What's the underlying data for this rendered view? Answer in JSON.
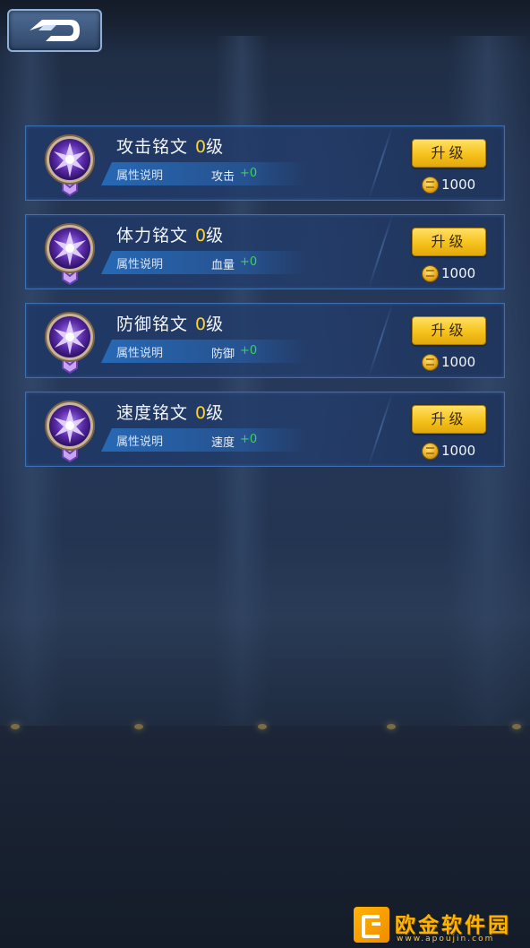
{
  "header": {
    "back_icon": "back-arrow-icon"
  },
  "runes": [
    {
      "name": "攻击铭文",
      "level": "0",
      "level_unit": "级",
      "attr_label": "属性说明",
      "attr_name": "攻击",
      "attr_value": "+0",
      "upgrade_label": "升级",
      "cost": "1000"
    },
    {
      "name": "体力铭文",
      "level": "0",
      "level_unit": "级",
      "attr_label": "属性说明",
      "attr_name": "血量",
      "attr_value": "+0",
      "upgrade_label": "升级",
      "cost": "1000"
    },
    {
      "name": "防御铭文",
      "level": "0",
      "level_unit": "级",
      "attr_label": "属性说明",
      "attr_name": "防御",
      "attr_value": "+0",
      "upgrade_label": "升级",
      "cost": "1000"
    },
    {
      "name": "速度铭文",
      "level": "0",
      "level_unit": "级",
      "attr_label": "属性说明",
      "attr_name": "速度",
      "attr_value": "+0",
      "upgrade_label": "升级",
      "cost": "1000"
    }
  ],
  "colors": {
    "level_highlight": "#ffd42a",
    "attr_value": "#3ad25a",
    "button": "#f6c21b",
    "row_border": "#3d6fb2"
  },
  "watermark": {
    "title": "欧金软件园",
    "url": "www.apoujin.com"
  }
}
